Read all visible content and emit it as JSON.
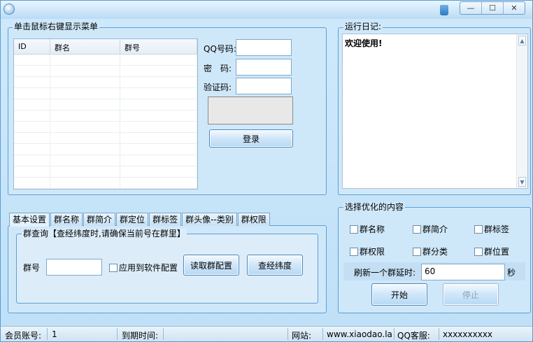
{
  "window": {
    "minimize": "—",
    "maximize": "☐",
    "close": "✕"
  },
  "table_panel": {
    "title": "单击鼠标右键显示菜单",
    "columns": [
      "ID",
      "群名",
      "群号"
    ]
  },
  "login": {
    "qq_label": "QQ号码:",
    "password_label": "密　码:",
    "captcha_label": "验证码:",
    "qq_value": "",
    "password_value": "",
    "captcha_value": "",
    "login_button": "登录"
  },
  "log_panel": {
    "title": "运行日记:",
    "text": "欢迎使用!"
  },
  "tabs": [
    "基本设置",
    "群名称",
    "群简介",
    "群定位",
    "群标签",
    "群头像--类别",
    "群权限"
  ],
  "query_group": {
    "title": "群查询【查经纬度时,请确保当前号在群里】",
    "group_label": "群号",
    "group_value": "",
    "apply_label": "应用到软件配置",
    "read_button": "读取群配置",
    "check_button": "查经纬度"
  },
  "optimize": {
    "title": "选择优化的内容",
    "options": [
      "群名称",
      "群简介",
      "群标签",
      "群权限",
      "群分类",
      "群位置"
    ],
    "delay_label": "刷新一个群延时:",
    "delay_value": "60",
    "delay_unit": "秒",
    "start_button": "开始",
    "stop_button": "停止"
  },
  "status": {
    "member_label": "会员账号:",
    "member_value": "1",
    "expire_label": "到期时间:",
    "expire_value": "",
    "site_label": "网站:",
    "site_value": "www.xiaodao.la",
    "qq_service_label": "QQ客服:",
    "qq_service_value": "xxxxxxxxxx"
  }
}
